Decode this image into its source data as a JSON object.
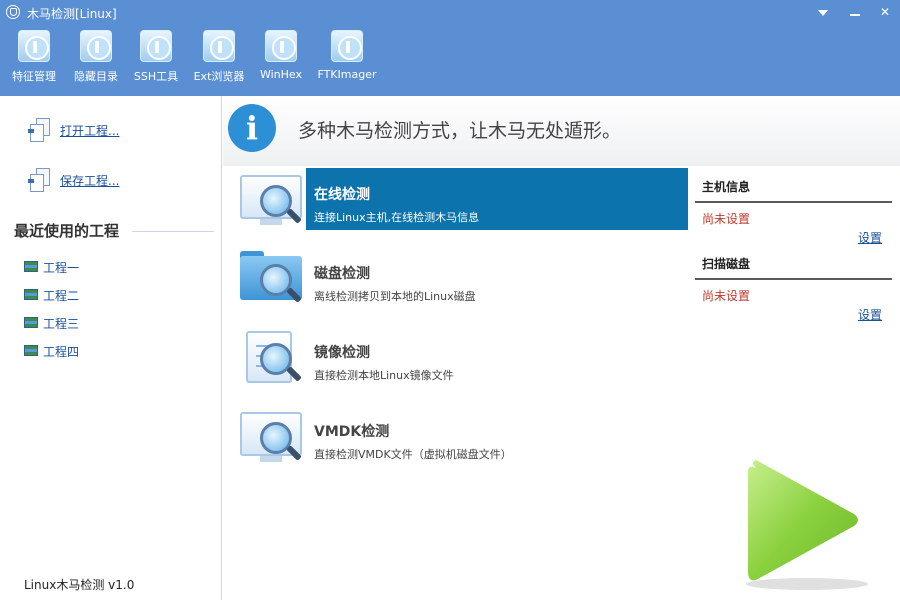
{
  "window": {
    "title": "木马检测[Linux]",
    "controls": [
      "menu-icon",
      "minimize-icon",
      "close-icon"
    ]
  },
  "toolbar": {
    "items": [
      {
        "label": "特征管理",
        "icon": "wifi-icon"
      },
      {
        "label": "隐藏目录",
        "icon": "wifi-icon"
      },
      {
        "label": "SSH工具",
        "icon": "wifi-icon"
      },
      {
        "label": "Ext浏览器",
        "icon": "wifi-icon"
      },
      {
        "label": "WinHex",
        "icon": "wifi-icon"
      },
      {
        "label": "FTKImager",
        "icon": "wifi-icon"
      }
    ]
  },
  "left": {
    "open_label": "打开工程...",
    "save_label": "保存工程...",
    "recent_title": "最近使用的工程",
    "recent": [
      "工程一",
      "工程二",
      "工程三",
      "工程四"
    ],
    "version": "Linux木马检测 v1.0"
  },
  "banner": {
    "text": "多种木马检测方式，让木马无处遁形。",
    "icon": "info-icon"
  },
  "detections": [
    {
      "title": "在线检测",
      "desc": "连接Linux主机,在线检测木马信息",
      "icon": "monitor-magnifier-icon",
      "selected": true
    },
    {
      "title": "磁盘检测",
      "desc": "离线检测拷贝到本地的Linux磁盘",
      "icon": "folder-magnifier-icon",
      "selected": false
    },
    {
      "title": "镜像检测",
      "desc": "直接检测本地Linux镜像文件",
      "icon": "clipboard-magnifier-icon",
      "selected": false
    },
    {
      "title": "VMDK检测",
      "desc": "直接检测VMDK文件（虚拟机磁盘文件）",
      "icon": "monitor-magnifier-icon",
      "selected": false
    }
  ],
  "right": {
    "host_title": "主机信息",
    "host_status": "尚未设置",
    "host_link": "设置",
    "disk_title": "扫描磁盘",
    "disk_status": "尚未设置",
    "disk_link": "设置"
  },
  "colors": {
    "toolbar_bg": "#5a8fd3",
    "selected_bg": "#0c73ad",
    "status_red": "#c0392b",
    "play_green": "#8bd13f"
  }
}
